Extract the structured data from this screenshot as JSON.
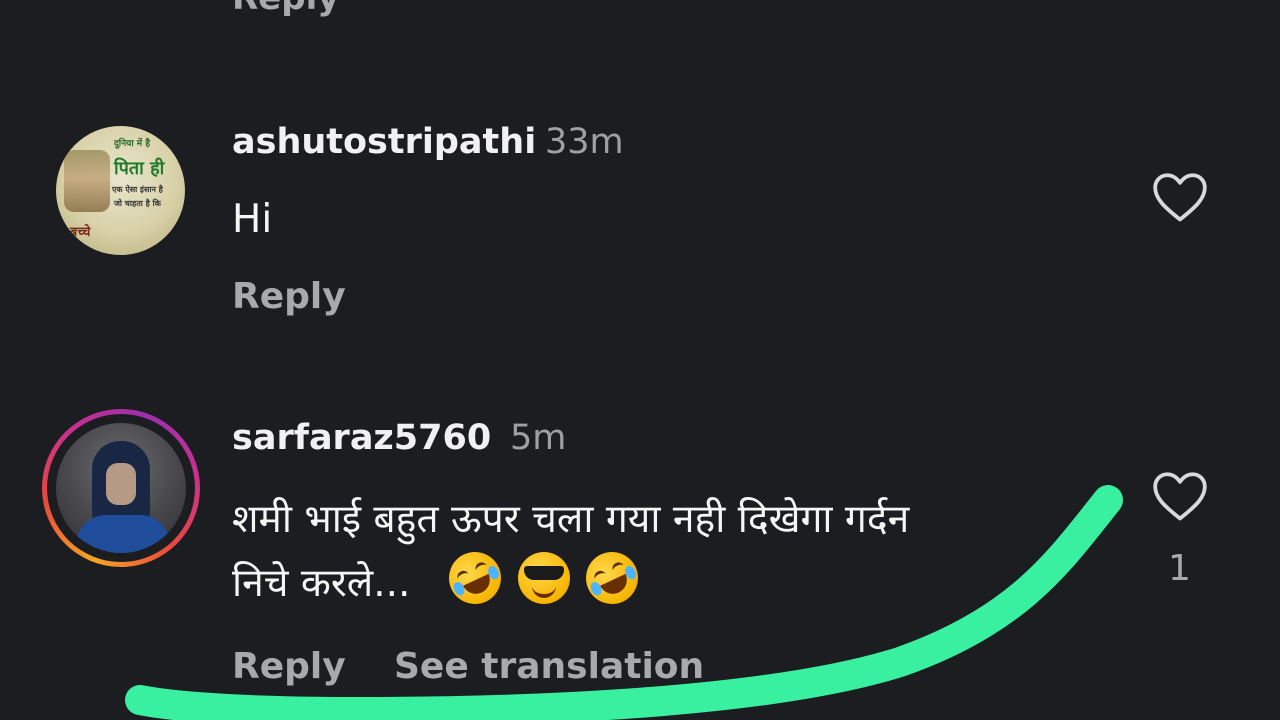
{
  "top": {
    "reply_label": "Reply"
  },
  "comments": [
    {
      "username": "ashutostripathi",
      "timestamp": "33m",
      "text_lines": [
        "Hi"
      ],
      "reply_label": "Reply",
      "avatar_lines": [
        "दुनिया में है",
        "पिता ही",
        "एक ऐसा इंसान है",
        "जो चाहता है कि",
        "रे बच्चे"
      ]
    },
    {
      "username": "sarfaraz5760",
      "timestamp": "5m",
      "text_lines": [
        "शमी भाई बहुत ऊपर चला गया नही दिखेगा गर्दन",
        "निचे करले..."
      ],
      "reply_label": "Reply",
      "see_translation_label": "See translation",
      "like_count": "1",
      "has_story_ring": true
    }
  ],
  "icons": {
    "like": "heart-outline-icon",
    "emoji_1": "rolling-on-floor-laughing-emoji",
    "emoji_2": "smiling-face-with-sunglasses-emoji",
    "emoji_3": "rolling-on-floor-laughing-emoji"
  },
  "colors": {
    "background": "#1c1d21",
    "text_primary": "#f1f1f3",
    "text_secondary": "#a8a9ad",
    "highlight_stroke": "#39f0a0"
  }
}
